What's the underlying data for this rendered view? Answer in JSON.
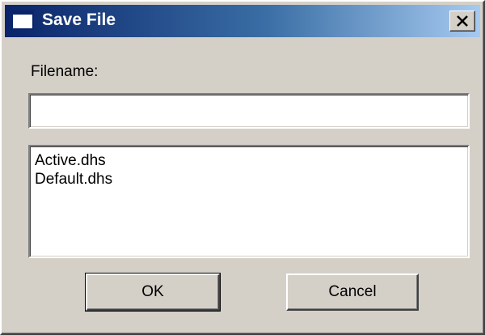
{
  "window": {
    "title": "Save File",
    "close_label": "Close"
  },
  "form": {
    "filename_label": "Filename:",
    "filename_value": "",
    "filename_placeholder": ""
  },
  "file_list": {
    "items": [
      "Active.dhs",
      "Default.dhs"
    ]
  },
  "buttons": {
    "ok_label": "OK",
    "cancel_label": "Cancel"
  },
  "colors": {
    "titlebar_start": "#0a246a",
    "titlebar_end": "#a6caf0",
    "face": "#d4d0c8"
  },
  "icons": {
    "app": "window-icon",
    "close": "close-icon"
  }
}
